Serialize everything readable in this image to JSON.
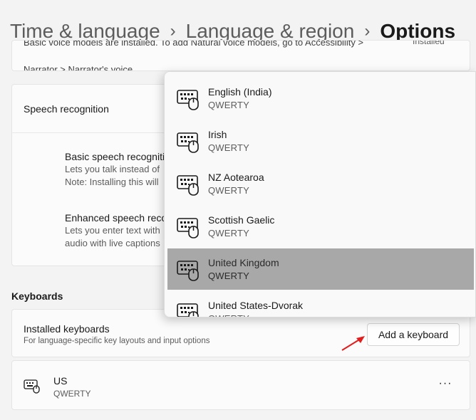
{
  "breadcrumb": {
    "items": [
      "Time & language",
      "Language & region"
    ],
    "separator": "›",
    "current": "Options"
  },
  "voice_card": {
    "line1": "Basic voice models are installed. To add Natural voice models, go to Accessibility >",
    "line2": "Narrator > Narrator's voice",
    "status": "Installed"
  },
  "speech": {
    "title": "Speech recognition",
    "items": [
      {
        "title": "Basic speech recognition",
        "desc1": "Lets you talk instead of",
        "desc2": "Note: Installing this will"
      },
      {
        "title": "Enhanced speech recognition",
        "desc1": "Lets you enter text with",
        "desc2": "audio with live captions"
      }
    ]
  },
  "keyboards": {
    "section_label": "Keyboards",
    "installed_title": "Installed keyboards",
    "installed_sub": "For language-specific key layouts and input options",
    "add_button": "Add a keyboard",
    "us": {
      "name": "US",
      "layout": "QWERTY",
      "more_label": "···",
      "icon": "keyboard-icon"
    }
  },
  "dropdown": {
    "icon": "keyboard-mouse-icon",
    "items": [
      {
        "name": "English (India)",
        "layout": "QWERTY",
        "selected": false
      },
      {
        "name": "Irish",
        "layout": "QWERTY",
        "selected": false
      },
      {
        "name": "NZ Aotearoa",
        "layout": "QWERTY",
        "selected": false
      },
      {
        "name": "Scottish Gaelic",
        "layout": "QWERTY",
        "selected": false
      },
      {
        "name": "United Kingdom",
        "layout": "QWERTY",
        "selected": true
      },
      {
        "name": "United States-Dvorak",
        "layout": "QWERTY",
        "selected": false
      }
    ]
  },
  "colors": {
    "annotation_arrow": "#e21d1d",
    "selected_row": "#a8a8a8"
  }
}
